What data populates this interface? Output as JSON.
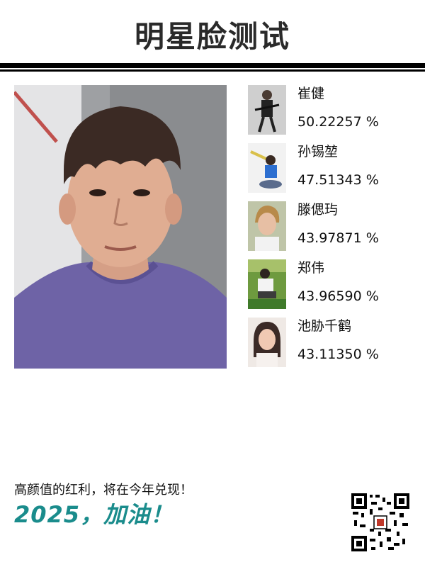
{
  "header": {
    "title": "明星脸测试"
  },
  "results": [
    {
      "name": "崔健",
      "score": "50.22257 %"
    },
    {
      "name": "孙锡堃",
      "score": "47.51343 %"
    },
    {
      "name": "滕偲玙",
      "score": "43.97871 %"
    },
    {
      "name": "郑伟",
      "score": "43.96590 %"
    },
    {
      "name": "池胁千鹤",
      "score": "43.11350 %"
    }
  ],
  "footer": {
    "slogan": "高颜值的红利，将在今年兑现！",
    "cheer": "2025，加油！"
  },
  "colors": {
    "accent": "#1a8c8c",
    "title": "#2a2a2a",
    "shirt": "#6e63a6"
  }
}
